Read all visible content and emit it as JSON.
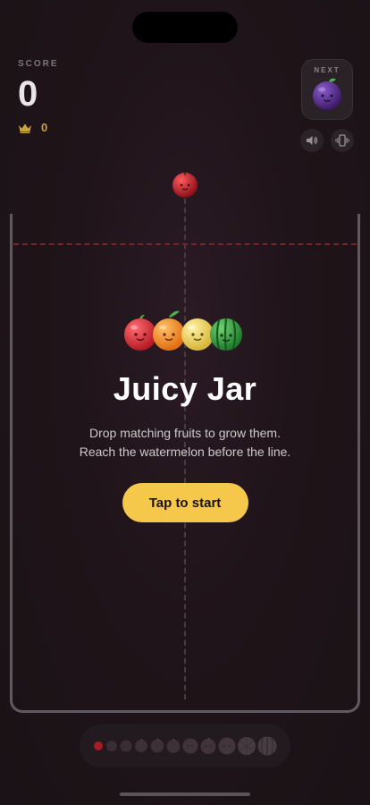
{
  "score": {
    "label": "SCORE",
    "value": "0",
    "best": "0"
  },
  "next": {
    "label": "NEXT",
    "fruit": "plum"
  },
  "controls": {
    "sound_icon": "speaker-icon",
    "vibrate_icon": "vibrate-icon"
  },
  "current_fruit": "cherry",
  "overlay": {
    "title": "Juicy Jar",
    "subtitle_line1": "Drop matching fruits to grow them.",
    "subtitle_line2": "Reach the watermelon before the line.",
    "start_label": "Tap to start",
    "hero_fruits": [
      "apple",
      "orange",
      "lemon",
      "watermelon"
    ]
  },
  "evolution": [
    "cherry",
    "strawberry",
    "grape",
    "dekopon",
    "persimmon",
    "apple",
    "pear",
    "peach",
    "pineapple",
    "melon",
    "watermelon"
  ],
  "colors": {
    "accent": "#f5c84b",
    "crown": "#c9a23a",
    "limit_line": "#6a2a2e",
    "cherry": "#d2242e",
    "apple": "#e8323c",
    "orange": "#f7902a",
    "lemon": "#f2d95a",
    "watermelon": "#3aa34a",
    "plum": "#5b2a8c"
  }
}
